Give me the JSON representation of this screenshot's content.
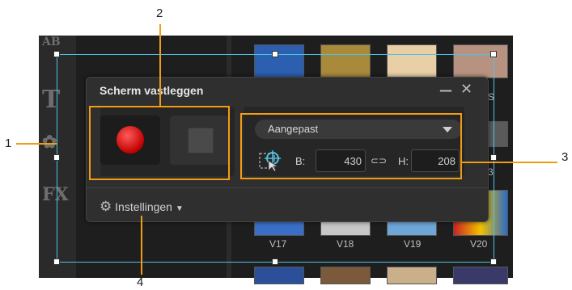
{
  "app": {
    "strip_icons": [
      "AB",
      "T",
      "FX"
    ],
    "video_labels": [
      "V17",
      "V18",
      "V19",
      "V20"
    ],
    "partial_label": "S",
    "partial_label2": "3"
  },
  "panel": {
    "title": "Scherm vastleggen",
    "minimize_icon": "minimize-icon",
    "close_icon": "close-icon",
    "dropdown_value": "Aangepast",
    "width_label": "B:",
    "width_value": "430",
    "height_label": "H:",
    "height_value": "208",
    "settings_label": "Instellingen"
  },
  "callouts": [
    "1",
    "2",
    "3",
    "4"
  ],
  "colors": {
    "callout_orange": "#f39c12",
    "selection_cyan": "#4ec3e6",
    "record_red": "#d00000",
    "panel_bg": "#2f2f2f"
  }
}
